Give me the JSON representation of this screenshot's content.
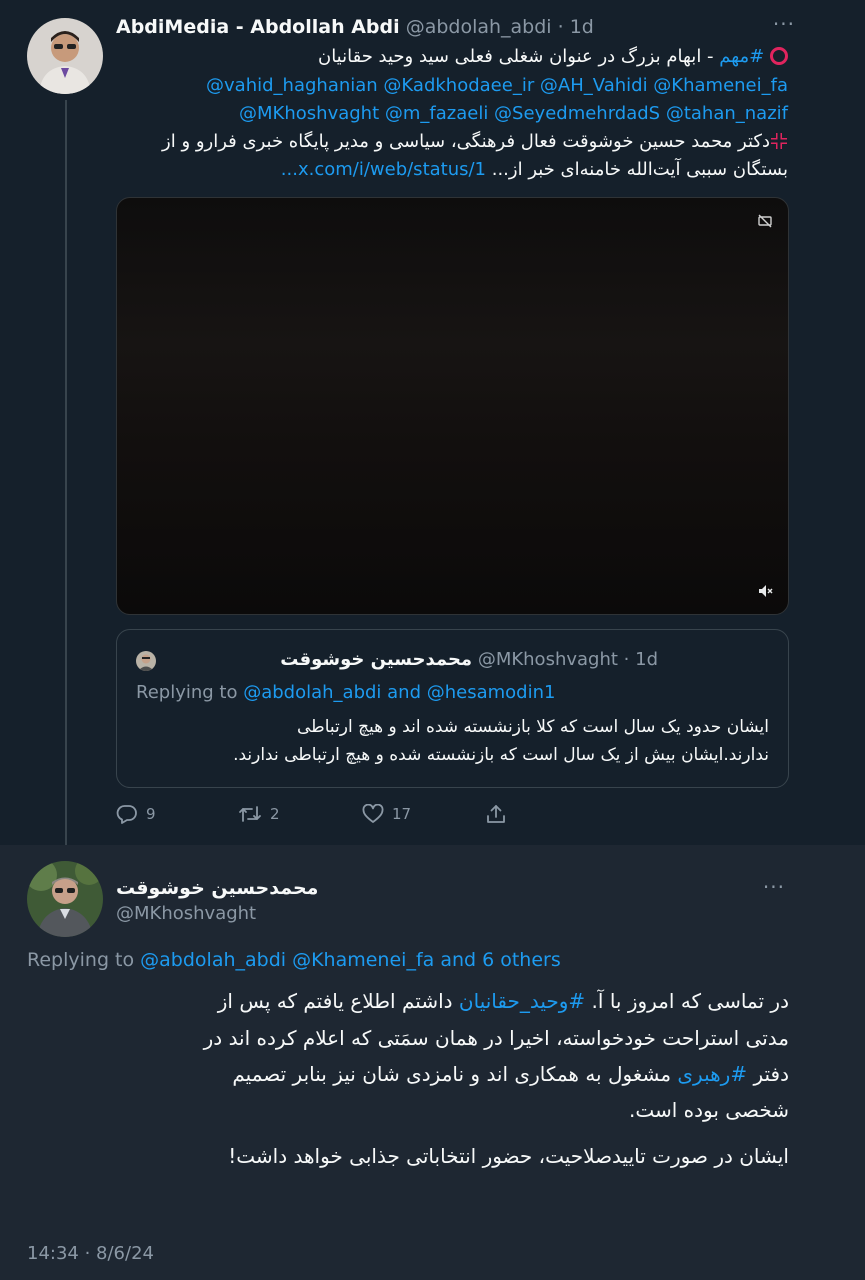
{
  "tweet1": {
    "name": "AbdiMedia - Abdollah Abdi",
    "handle": "@abdolah_abdi",
    "time": "· 1d",
    "line1_hashtag": "#مهم",
    "line1_text": " - ابهام بزرگ در عنوان شغلی فعلی سید وحید حقانیان",
    "line2": "@vahid_haghanian @Kadkhodaee_ir @AH_Vahidi @Khamenei_fa",
    "line3": "@MKhoshvaght @m_fazaeli @SeyedmehrdadS @tahan_nazif",
    "line4": "دکتر محمد حسین خوشوقت فعال فرهنگی، سیاسی و مدیر پایگاه خبری فرارو و از",
    "line5_text": "بستگان سببی آیت‌الله خامنه‌ای خبر از... ",
    "line5_link": "x.com/i/web/status/1...",
    "colors": {
      "accent": "#1d9bf0",
      "red_icon": "#e0245e"
    },
    "video_icons": [
      "quality-icon",
      "mute-icon"
    ]
  },
  "quote": {
    "name": "محمدحسین خوشوقت",
    "handle": "@MKhoshvaght",
    "time": "· 1d",
    "replying_prefix": "Replying to ",
    "replying_to": "@abdolah_abdi and @hesamodin1",
    "line1": "ایشان حدود یک سال است که کلا بازنشسته شده اند و هیچ ارتباطی",
    "line2": "ندارند.ایشان بیش از یک سال است که بازنشسته شده و هیچ ارتباطی ندارند."
  },
  "actions": {
    "replies": "9",
    "retweets": "2",
    "likes": "17"
  },
  "tweet2": {
    "name": "محمدحسین خوشوقت",
    "handle": "@MKhoshvaght",
    "replying_prefix": "Replying to ",
    "replying_to": "@abdolah_abdi @Khamenei_fa and 6 others",
    "line1_a": "در تماسی که امروز با آ. ",
    "line1_tag": "#وحید_حقانیان",
    "line1_b": " داشتم اطلاع یافتم که  پس از",
    "line2": "مدتی استراحت خودخواسته، اخیرا در همان سمَتی که اعلام کرده اند در",
    "line3_a": "دفتر ",
    "line3_tag": "#رهبری",
    "line3_b": " مشغول به همکاری اند و نامزدی شان نیز بنابر تصمیم",
    "line4": "شخصی بوده است.",
    "line5": "ایشان در صورت تاییدصلاحیت، حضور انتخاباتی جذابی خواهد داشت!",
    "timestamp": "14:34 · 8/6/24"
  }
}
